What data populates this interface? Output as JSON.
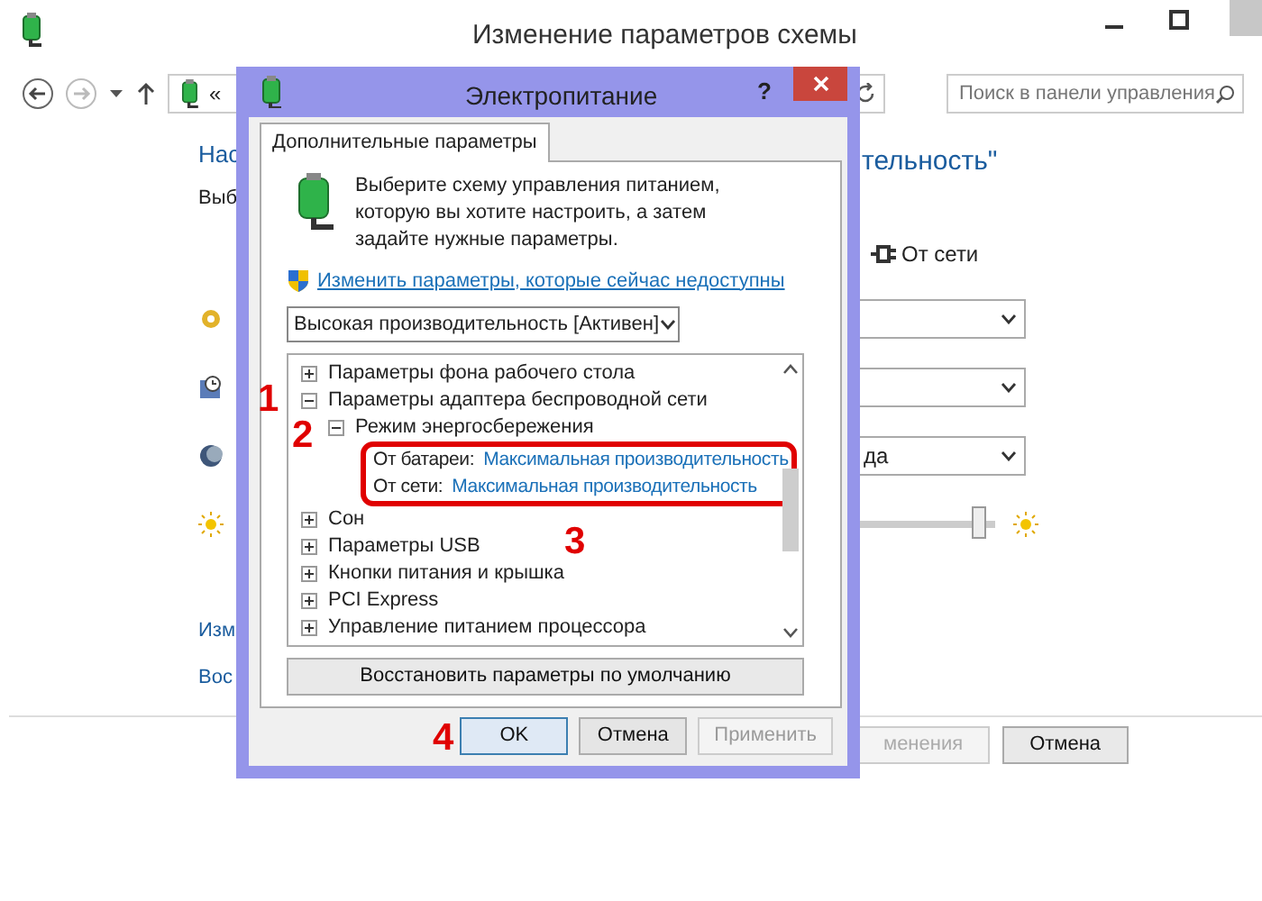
{
  "window": {
    "title": "Изменение параметров схемы"
  },
  "toolbar": {
    "forward": {
      "disabled": true
    },
    "address": "«",
    "search": {
      "placeholder": "Поиск в панели управления"
    }
  },
  "page": {
    "heading_start": "Нас",
    "heading_end": "тельность\"",
    "subtitle": "Выб",
    "column_header": "От сети",
    "settings": [
      {
        "kind": "select"
      },
      {
        "kind": "select"
      },
      {
        "kind": "select",
        "value": "да"
      },
      {
        "kind": "slider",
        "level": 0.88
      }
    ],
    "links": [
      "Изм",
      "Вос"
    ],
    "buttons": [
      {
        "label": "менения",
        "disabled": true
      },
      {
        "label": "Отмена",
        "disabled": false
      }
    ]
  },
  "dialog": {
    "title": "Электропитание",
    "help": "?",
    "tabs": [
      {
        "label": "Дополнительные параметры",
        "selected": true
      }
    ],
    "intro": "Выберите схему управления питанием, которую вы хотите настроить, а затем задайте нужные параметры.",
    "admin_link": "Изменить параметры, которые сейчас недоступны",
    "scheme": "Высокая производительность [Активен]",
    "tree": [
      {
        "label": "Параметры фона рабочего стола",
        "expanded": false
      },
      {
        "label": "Параметры адаптера беспроводной сети",
        "expanded": true,
        "marker": "1",
        "children": [
          {
            "label": "Режим энергосбережения",
            "expanded": true,
            "marker": "2",
            "settings": {
              "highlighted": true,
              "marker": "3",
              "items": [
                {
                  "label": "От батареи:",
                  "value": "Максимальная производительность"
                },
                {
                  "label": "От сети:",
                  "value": "Максимальная производительность"
                }
              ]
            }
          }
        ]
      },
      {
        "label": "Сон",
        "expanded": false
      },
      {
        "label": "Параметры USB",
        "expanded": false
      },
      {
        "label": "Кнопки питания и крышка",
        "expanded": false
      },
      {
        "label": "PCI Express",
        "expanded": false
      },
      {
        "label": "Управление питанием процессора",
        "expanded": false
      }
    ],
    "restore_button": "Восстановить параметры по умолчанию",
    "buttons": [
      {
        "label": "OK",
        "default": true,
        "disabled": false,
        "marker": "4"
      },
      {
        "label": "Отмена",
        "default": false,
        "disabled": false
      },
      {
        "label": "Применить",
        "default": false,
        "disabled": true
      }
    ]
  }
}
